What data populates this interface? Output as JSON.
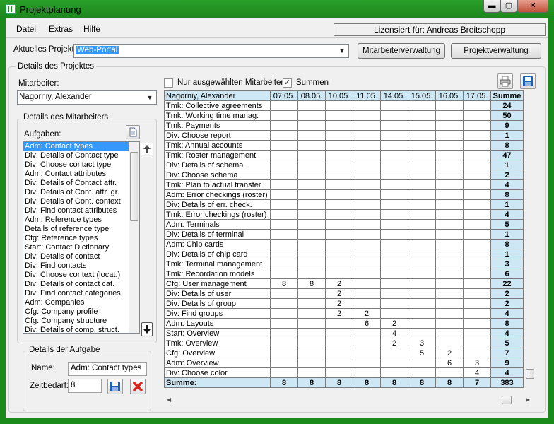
{
  "window": {
    "title": "Projektplanung"
  },
  "menu": [
    "Datei",
    "Extras",
    "Hilfe"
  ],
  "license": "Lizensiert für: Andreas Breitschopp",
  "project": {
    "label": "Aktuelles Projekt:",
    "value": "Web-Portal",
    "employees_button": "Mitarbeiterverwaltung",
    "projects_button": "Projektverwaltung"
  },
  "details": {
    "title": "Details des Projektes",
    "employee_label": "Mitarbeiter:",
    "employee_value": "Nagorniy, Alexander",
    "employee_group": "Details des Mitarbeiters",
    "tasks_label": "Aufgaben:",
    "tasks": [
      "Adm: Contact types",
      "Div: Details of Contact type",
      "Div: Choose contact type",
      "Adm: Contact attributes",
      "Div: Details of Contact attr.",
      "Div: Details of Cont. attr. gr.",
      "Div: Details of Cont. context",
      "Div: Find contact attributes",
      "Adm: Reference types",
      "Details of reference type",
      "Cfg: Reference types",
      "Start: Contact Dictionary",
      "Div: Details of contact",
      "Div: Find contacts",
      "Div: Choose context (locat.)",
      "Div: Details of contact cat.",
      "Div: Find contact categories",
      "Adm: Companies",
      "Cfg: Company profile",
      "Cfg: Company structure",
      "Div: Details of comp. struct."
    ],
    "task_group": "Details der Aufgabe",
    "name_label": "Name:",
    "name_value": "Adm: Contact types",
    "time_label": "Zeitbedarf:",
    "time_value": "8"
  },
  "filters": {
    "only_selected": "Nur ausgewählten Mitarbeiter",
    "sums": "Summen",
    "sums_checked": "✓"
  },
  "grid": {
    "header": "Nagorniy, Alexander",
    "dates": [
      "07.05.",
      "08.05.",
      "10.05.",
      "11.05.",
      "14.05.",
      "15.05.",
      "16.05.",
      "17.05."
    ],
    "sum_header": "Summe",
    "rows": [
      {
        "name": "Tmk: Collective agreements",
        "cells": [
          "",
          "",
          "",
          "",
          "",
          "",
          "",
          ""
        ],
        "sum": "24"
      },
      {
        "name": "Tmk: Working time manag.",
        "cells": [
          "",
          "",
          "",
          "",
          "",
          "",
          "",
          ""
        ],
        "sum": "50"
      },
      {
        "name": "Tmk: Payments",
        "cells": [
          "",
          "",
          "",
          "",
          "",
          "",
          "",
          ""
        ],
        "sum": "9"
      },
      {
        "name": "Div: Choose report",
        "cells": [
          "",
          "",
          "",
          "",
          "",
          "",
          "",
          ""
        ],
        "sum": "1"
      },
      {
        "name": "Tmk: Annual accounts",
        "cells": [
          "",
          "",
          "",
          "",
          "",
          "",
          "",
          ""
        ],
        "sum": "8"
      },
      {
        "name": "Tmk: Roster management",
        "cells": [
          "",
          "",
          "",
          "",
          "",
          "",
          "",
          ""
        ],
        "sum": "47"
      },
      {
        "name": "Div: Details of schema",
        "cells": [
          "",
          "",
          "",
          "",
          "",
          "",
          "",
          ""
        ],
        "sum": "1"
      },
      {
        "name": "Div: Choose schema",
        "cells": [
          "",
          "",
          "",
          "",
          "",
          "",
          "",
          ""
        ],
        "sum": "2"
      },
      {
        "name": "Tmk: Plan to actual transfer",
        "cells": [
          "",
          "",
          "",
          "",
          "",
          "",
          "",
          ""
        ],
        "sum": "4"
      },
      {
        "name": "Adm: Error checkings (roster)",
        "cells": [
          "",
          "",
          "",
          "",
          "",
          "",
          "",
          ""
        ],
        "sum": "8"
      },
      {
        "name": "Div: Details of err. check.",
        "cells": [
          "",
          "",
          "",
          "",
          "",
          "",
          "",
          ""
        ],
        "sum": "1"
      },
      {
        "name": "Tmk: Error checkings (roster)",
        "cells": [
          "",
          "",
          "",
          "",
          "",
          "",
          "",
          ""
        ],
        "sum": "4"
      },
      {
        "name": "Adm: Terminals",
        "cells": [
          "",
          "",
          "",
          "",
          "",
          "",
          "",
          ""
        ],
        "sum": "5"
      },
      {
        "name": "Div: Details of terminal",
        "cells": [
          "",
          "",
          "",
          "",
          "",
          "",
          "",
          ""
        ],
        "sum": "1"
      },
      {
        "name": "Adm: Chip cards",
        "cells": [
          "",
          "",
          "",
          "",
          "",
          "",
          "",
          ""
        ],
        "sum": "8"
      },
      {
        "name": "Div: Details of chip card",
        "cells": [
          "",
          "",
          "",
          "",
          "",
          "",
          "",
          ""
        ],
        "sum": "1"
      },
      {
        "name": "Tmk: Terminal management",
        "cells": [
          "",
          "",
          "",
          "",
          "",
          "",
          "",
          ""
        ],
        "sum": "3"
      },
      {
        "name": "Tmk: Recordation models",
        "cells": [
          "",
          "",
          "",
          "",
          "",
          "",
          "",
          ""
        ],
        "sum": "6"
      },
      {
        "name": "Cfg: User management",
        "cells": [
          "8",
          "8",
          "2",
          "",
          "",
          "",
          "",
          ""
        ],
        "sum": "22"
      },
      {
        "name": "Div: Details of user",
        "cells": [
          "",
          "",
          "2",
          "",
          "",
          "",
          "",
          ""
        ],
        "sum": "2"
      },
      {
        "name": "Div: Details of group",
        "cells": [
          "",
          "",
          "2",
          "",
          "",
          "",
          "",
          ""
        ],
        "sum": "2"
      },
      {
        "name": "Div: Find groups",
        "cells": [
          "",
          "",
          "2",
          "2",
          "",
          "",
          "",
          ""
        ],
        "sum": "4"
      },
      {
        "name": "Adm: Layouts",
        "cells": [
          "",
          "",
          "",
          "6",
          "2",
          "",
          "",
          ""
        ],
        "sum": "8"
      },
      {
        "name": "Start: Overview",
        "cells": [
          "",
          "",
          "",
          "",
          "4",
          "",
          "",
          ""
        ],
        "sum": "4"
      },
      {
        "name": "Tmk: Overview",
        "cells": [
          "",
          "",
          "",
          "",
          "2",
          "3",
          "",
          ""
        ],
        "sum": "5"
      },
      {
        "name": "Cfg: Overview",
        "cells": [
          "",
          "",
          "",
          "",
          "",
          "5",
          "2",
          ""
        ],
        "sum": "7"
      },
      {
        "name": "Adm: Overview",
        "cells": [
          "",
          "",
          "",
          "",
          "",
          "",
          "6",
          "3"
        ],
        "sum": "9"
      },
      {
        "name": "Div: Choose color",
        "cells": [
          "",
          "",
          "",
          "",
          "",
          "",
          "",
          "4"
        ],
        "sum": "4"
      }
    ],
    "footer": {
      "name": "Summe:",
      "cells": [
        "8",
        "8",
        "8",
        "8",
        "8",
        "8",
        "8",
        "7"
      ],
      "sum": "383"
    }
  }
}
